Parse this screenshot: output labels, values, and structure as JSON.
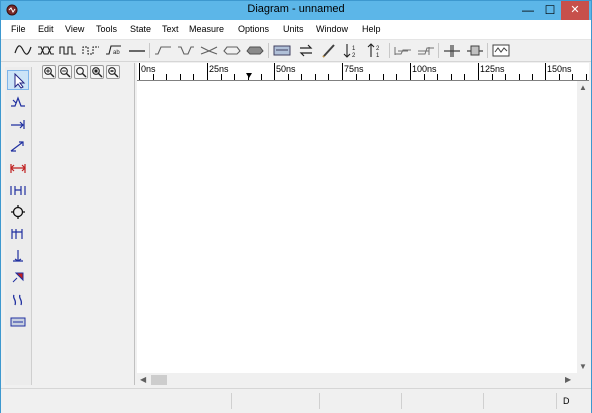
{
  "window": {
    "title": "Diagram - unnamed",
    "minimize": "—",
    "maximize": "☐",
    "close": "✕"
  },
  "menu": [
    "File",
    "Edit",
    "View",
    "Tools",
    "State",
    "Text",
    "Measure",
    "Options",
    "Units",
    "Window",
    "Help"
  ],
  "toolbar_icons": [
    "clock-wave-icon",
    "bus-wave-icon",
    "pulse-wave-icon",
    "dotted-wave-icon",
    "label-wave-icon",
    "line-icon",
    "high-state-icon",
    "low-state-icon",
    "tristate-icon",
    "bus-valid-icon",
    "bus-filled-icon",
    "display-icon",
    "swap-icon",
    "pencil-icon",
    "sort-ascending-icon",
    "sort-descending-icon",
    "delay-icon",
    "setup-icon",
    "insert-time-icon",
    "delete-time-icon",
    "waveform-view-icon"
  ],
  "tool_icons": [
    "select-arrow-icon",
    "edge-tool-icon",
    "delay-arrow-icon",
    "setup-arrow-icon",
    "measure-icon",
    "hold-icon",
    "crosshair-icon",
    "marker-icon",
    "anchor-icon",
    "pin-icon",
    "break-icon",
    "text-box-icon"
  ],
  "zoom_icons": [
    "zoom-in-icon",
    "zoom-out-icon",
    "zoom-fit-icon",
    "zoom-full-icon",
    "zoom-previous-icon"
  ],
  "ruler": {
    "labels": [
      "0ns",
      "25ns",
      "50ns",
      "75ns",
      "100ns",
      "125ns",
      "150ns"
    ]
  },
  "status": {
    "mode": "D"
  }
}
